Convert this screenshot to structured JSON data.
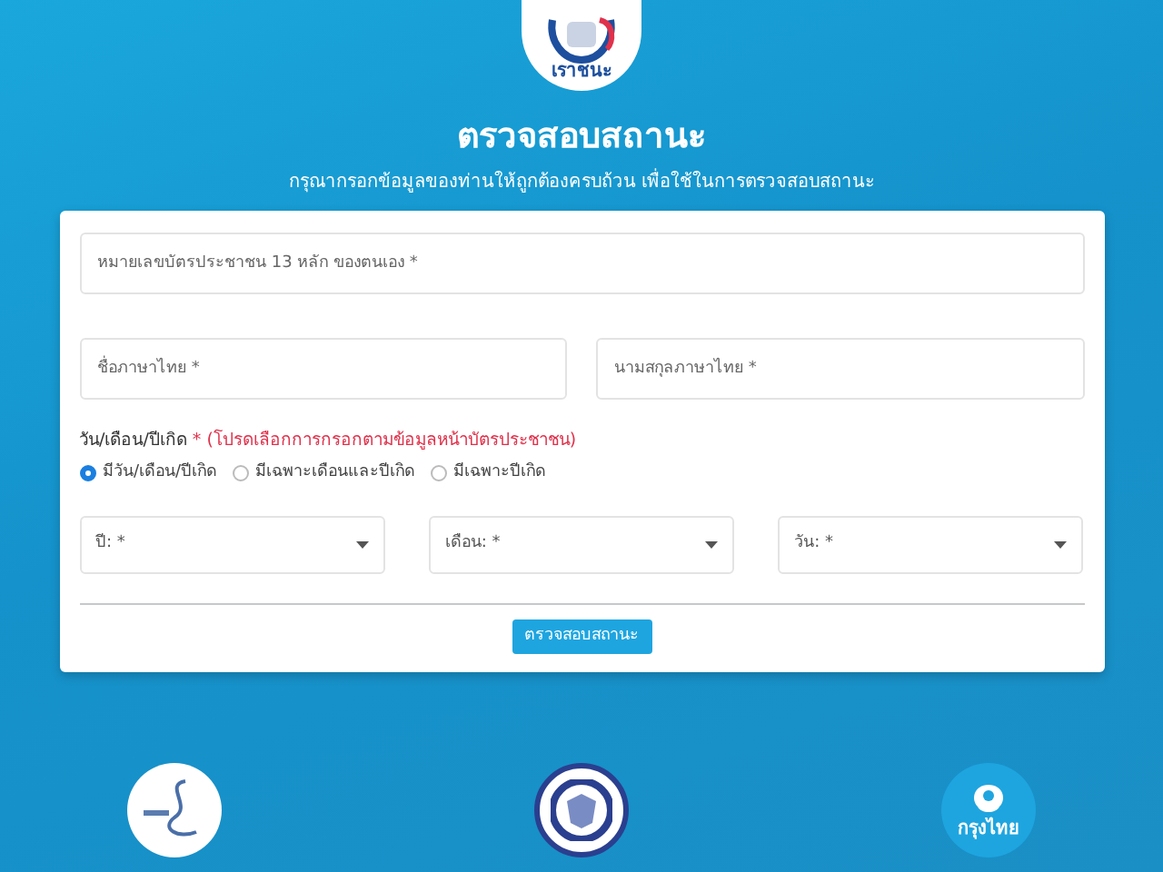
{
  "logo": {
    "text": "เราชนะ"
  },
  "title": "ตรวจสอบสถานะ",
  "subtitle": "กรุณากรอกข้อมูลของท่านให้ถูกต้องครบถ้วน เพื่อใช้ในการตรวจสอบสถานะ",
  "form": {
    "id_field": {
      "placeholder": "หมายเลขบัตรประชาชน 13 หลัก ของตนเอง *"
    },
    "name_fields": [
      {
        "placeholder": "ชื่อภาษาไทย *"
      },
      {
        "placeholder": "นามสกุลภาษาไทย *"
      }
    ],
    "dob": {
      "label": "วัน/เดือน/ปีเกิด",
      "required_mark": "*",
      "hint": "(โปรดเลือกการกรอกตามข้อมูลหน้าบัตรประชาชน)"
    },
    "dob_options": [
      {
        "label": "มีวัน/เดือน/ปีเกิด",
        "selected": true
      },
      {
        "label": "มีเฉพาะเดือนและปีเกิด",
        "selected": false
      },
      {
        "label": "มีเฉพาะปีเกิด",
        "selected": false
      }
    ],
    "selects": [
      {
        "placeholder": "ปี: *"
      },
      {
        "placeholder": "เดือน: *"
      },
      {
        "placeholder": "วัน: *"
      }
    ],
    "submit": "ตรวจสอบสถานะ"
  },
  "footer_logos": [
    {
      "kind": "sso"
    },
    {
      "kind": "seal"
    },
    {
      "kind": "bank",
      "text": "กรุงไทย"
    }
  ]
}
